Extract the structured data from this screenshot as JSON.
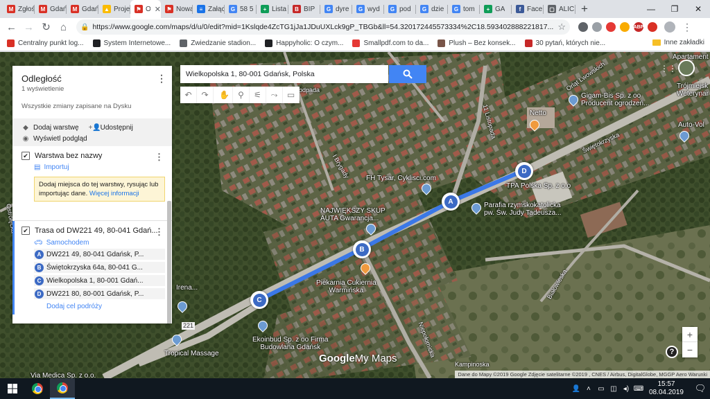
{
  "browser": {
    "tabs": [
      {
        "title": "Zgłoś",
        "color": "#d93025",
        "glyph": "M"
      },
      {
        "title": "Gdańsk",
        "color": "#d93025",
        "glyph": "M"
      },
      {
        "title": "Gdańsk",
        "color": "#d93025",
        "glyph": "M"
      },
      {
        "title": "Projekt",
        "color": "#fbbc04",
        "glyph": "▲"
      },
      {
        "title": "Odl",
        "color": "#d93025",
        "glyph": "⚑",
        "active": true
      },
      {
        "title": "Nowa",
        "color": "#d93025",
        "glyph": "⚑"
      },
      {
        "title": "Załącznik",
        "color": "#1a73e8",
        "glyph": "≡"
      },
      {
        "title": "58 5",
        "color": "#4285f4",
        "glyph": "G"
      },
      {
        "title": "Lista",
        "color": "#0f9d58",
        "glyph": "+"
      },
      {
        "title": "BIP",
        "color": "#c62828",
        "glyph": "B"
      },
      {
        "title": "dyre",
        "color": "#4285f4",
        "glyph": "G"
      },
      {
        "title": "wyd",
        "color": "#4285f4",
        "glyph": "G"
      },
      {
        "title": "pod",
        "color": "#4285f4",
        "glyph": "G"
      },
      {
        "title": "dzie",
        "color": "#4285f4",
        "glyph": "G"
      },
      {
        "title": "tom",
        "color": "#4285f4",
        "glyph": "G"
      },
      {
        "title": "GA",
        "color": "#0f9d58",
        "glyph": "+"
      },
      {
        "title": "Face",
        "color": "#3b5998",
        "glyph": "f"
      },
      {
        "title": "ALIC",
        "color": "#5f6368",
        "glyph": "▢"
      }
    ],
    "new_tab": "+",
    "window_controls": [
      "—",
      "❐",
      "✕"
    ],
    "url": "https://www.google.com/maps/d/u/0/edit?mid=1Kslqde4ZcTG1jJa1JDuUXLck9gP_TBGb&ll=54.320172445573334%2C18.593402888221817...",
    "bookmarks": [
      {
        "label": "Centralny punkt log...",
        "color": "#d93025"
      },
      {
        "label": "System Internetowe...",
        "color": "#202124"
      },
      {
        "label": "Zwiedzanie stadion...",
        "color": "#5f6368"
      },
      {
        "label": "Happyholic: O czym...",
        "color": "#202124"
      },
      {
        "label": "Smallpdf.com to da...",
        "color": "#e53935"
      },
      {
        "label": "Plush – Bez konsek...",
        "color": "#795548"
      },
      {
        "label": "30 pytań, których nie...",
        "color": "#c62828"
      }
    ],
    "other_bookmarks": "Inne zakładki"
  },
  "map": {
    "search_value": "Wielkopolska 1, 80-001 Gdańsk, Polska",
    "tools": [
      "↶",
      "↷",
      "✋",
      "⚲",
      "⚟",
      "⤳",
      "▭"
    ],
    "labels": {
      "netto": "Netto",
      "gigam": "Gigam-Bis Sp. z oo\nProducent ogrodzeń...",
      "tpa": "TPA Polska Sp. z o.o",
      "parafia": "Parafia rzymskokatolicka\npw. Św. Judy Tadeusza...",
      "fh": "FH Tysar, Cyklisci.com",
      "skup": "NAJWIĘKSZY SKUP\nAUTA Gwarancja...",
      "piekarnia": "Piekarnia Cukiernia\nWarmińska",
      "ekoinbud": "Ekoinbud Sp. z oo Firma\nBudowlana Gdańsk",
      "tropical": "Tropical Massage",
      "irena": "Irena...",
      "trojmiejska": "Trójmiejsk\nWeterynar",
      "autovol": "Auto-Vol",
      "apartament": "Apartament",
      "via": "Via Medica Sp. z o.o."
    },
    "streets": {
      "swietokrzyska": "Świętokrzyska",
      "brygady": "I Brygady",
      "listopada": "11 Listopada",
      "lwowskich": "Orląt Lwowskich",
      "bialowieska": "Białowieska",
      "niepolomicka": "Niepołomicka",
      "kampinoska": "Kampinoska",
      "ostroleka": "Ostrołęcka",
      "road221": "221",
      "podpada": "Podpada"
    },
    "markers": [
      "A",
      "B",
      "C",
      "D"
    ],
    "logo_bold": "Google",
    "logo_thin": "My Maps",
    "attribution": "Dane do Mapy ©2019 Google Zdjęcie satelitarne ©2019 , CNES / Airbus, DigitalGlobe, MGGP Aero   Warunki",
    "zoom_in": "+",
    "zoom_out": "−",
    "help": "?"
  },
  "panel": {
    "title": "Odległość",
    "views": "1 wyświetlenie",
    "saved": "Wszystkie zmiany zapisane na Dysku",
    "add_layer": "Dodaj warstwę",
    "share": "Udostępnij",
    "preview": "Wyświetl podgląd",
    "layer1": {
      "title": "Warstwa bez nazwy",
      "import": "Importuj",
      "hint": "Dodaj miejsca do tej warstwy, rysując lub importując dane.",
      "hint_link": "Więcej informacji"
    },
    "layer2": {
      "title": "Trasa od DW221 49, 80-041 Gdań...",
      "mode": "Samochodem",
      "stops": [
        {
          "letter": "A",
          "text": "DW221 49, 80-041 Gdańsk, P..."
        },
        {
          "letter": "B",
          "text": "Świętokrzyska 64a, 80-041 G..."
        },
        {
          "letter": "C",
          "text": "Wielkopolska 1, 80-001 Gdań..."
        },
        {
          "letter": "D",
          "text": "DW221 80, 80-001 Gdańsk, P..."
        }
      ],
      "add_destination": "Dodaj cel podróży"
    }
  },
  "taskbar": {
    "time": "15:57",
    "date": "08.04.2019"
  },
  "colors": {
    "accent": "#4285f4",
    "route": "#3b78e7",
    "marker": "#3c6ac4"
  }
}
